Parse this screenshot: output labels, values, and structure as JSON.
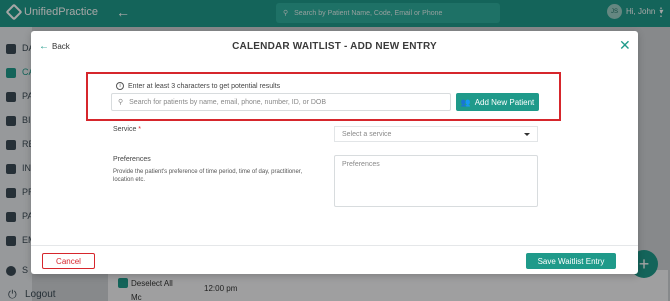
{
  "app": {
    "logo": "UnifiedPractice",
    "top_search_placeholder": "Search by Patient Name, Code, Email or Phone",
    "user_initials": "JS",
    "user_greeting": "Hi, John"
  },
  "sidebar": {
    "items": [
      {
        "label": "DA",
        "icon": "dashboard-icon"
      },
      {
        "label": "CA",
        "icon": "calendar-icon"
      },
      {
        "label": "PA",
        "icon": "patients-icon"
      },
      {
        "label": "BI",
        "icon": "billing-icon"
      },
      {
        "label": "RE",
        "icon": "reports-icon"
      },
      {
        "label": "IN",
        "icon": "inventory-icon"
      },
      {
        "label": "PR",
        "icon": "products-icon"
      },
      {
        "label": "PA",
        "icon": "payments-icon"
      },
      {
        "label": "EM",
        "icon": "email-icon"
      },
      {
        "label": "S",
        "icon": "settings-icon"
      }
    ],
    "logout": "Logout"
  },
  "background": {
    "deselect_all": "Deselect All",
    "time": "12:00 pm",
    "mc_label": "Mc"
  },
  "modal": {
    "back_label": "Back",
    "title": "CALENDAR WAITLIST - ADD NEW ENTRY",
    "hint": "Enter at least 3 characters to get potential results",
    "search_placeholder": "Search for patients by name, email, phone, number, ID, or DOB",
    "add_patient_label": "Add New Patient",
    "service_label": "Service",
    "service_required": "*",
    "service_placeholder": "Select a service",
    "preferences_label": "Preferences",
    "preferences_desc": "Provide the patient's preference of time period, time of day, practitioner, location etc.",
    "preferences_placeholder": "Preferences",
    "cancel_label": "Cancel",
    "save_label": "Save Waitlist Entry"
  },
  "colors": {
    "brand": "#1f9a8a",
    "danger": "#d6262c"
  }
}
